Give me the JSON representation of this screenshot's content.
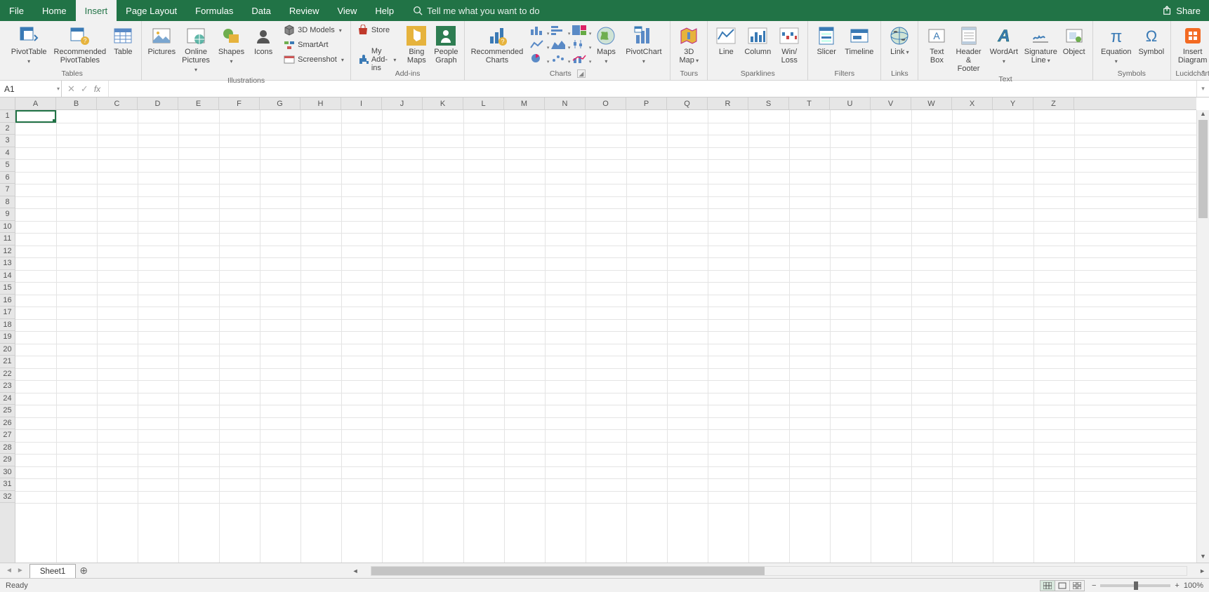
{
  "tabs": {
    "items": [
      "File",
      "Home",
      "Insert",
      "Page Layout",
      "Formulas",
      "Data",
      "Review",
      "View",
      "Help"
    ],
    "active": "Insert"
  },
  "tellme": {
    "placeholder": "Tell me what you want to do"
  },
  "share": {
    "label": "Share"
  },
  "ribbon": {
    "tables": {
      "label": "Tables",
      "pivottable": "PivotTable",
      "recpivot": "Recommended\nPivotTables",
      "table": "Table"
    },
    "illus": {
      "label": "Illustrations",
      "pictures": "Pictures",
      "online": "Online\nPictures",
      "shapes": "Shapes",
      "icons": "Icons",
      "models3d": "3D Models",
      "smartart": "SmartArt",
      "screenshot": "Screenshot"
    },
    "addins": {
      "label": "Add-ins",
      "store": "Store",
      "myaddins": "My Add-ins",
      "bing": "Bing\nMaps",
      "people": "People\nGraph"
    },
    "charts": {
      "label": "Charts",
      "recommended": "Recommended\nCharts",
      "maps": "Maps",
      "pivotchart": "PivotChart"
    },
    "tours": {
      "label": "Tours",
      "map3d": "3D\nMap"
    },
    "sparklines": {
      "label": "Sparklines",
      "line": "Line",
      "column": "Column",
      "winloss": "Win/\nLoss"
    },
    "filters": {
      "label": "Filters",
      "slicer": "Slicer",
      "timeline": "Timeline"
    },
    "links": {
      "label": "Links",
      "link": "Link"
    },
    "text": {
      "label": "Text",
      "textbox": "Text\nBox",
      "headerfooter": "Header\n& Footer",
      "wordart": "WordArt",
      "sigline": "Signature\nLine",
      "object": "Object"
    },
    "symbols": {
      "label": "Symbols",
      "equation": "Equation",
      "symbol": "Symbol"
    },
    "lucid": {
      "label": "Lucidchart",
      "insert": "Insert\nDiagram"
    }
  },
  "fbar": {
    "namebox": "A1",
    "fx": "fx",
    "value": ""
  },
  "grid": {
    "columns": [
      "A",
      "B",
      "C",
      "D",
      "E",
      "F",
      "G",
      "H",
      "I",
      "J",
      "K",
      "L",
      "M",
      "N",
      "O",
      "P",
      "Q",
      "R",
      "S",
      "T",
      "U",
      "V",
      "W",
      "X",
      "Y",
      "Z"
    ],
    "firstRow": 1,
    "rowCount": 32,
    "activeCell": "A1"
  },
  "sheets": {
    "active": "Sheet1"
  },
  "status": {
    "ready": "Ready",
    "zoom": "100%"
  }
}
